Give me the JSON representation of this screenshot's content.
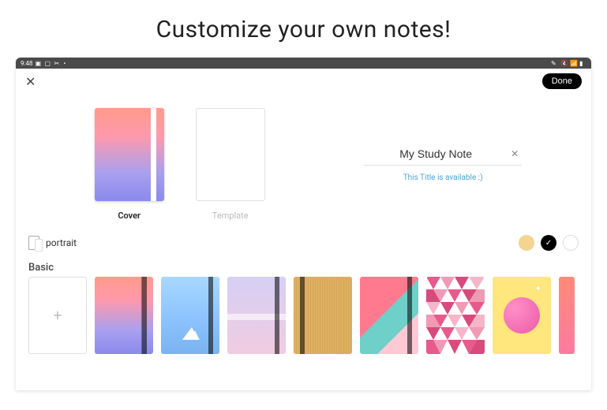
{
  "page_title": "Customize your own notes!",
  "status": {
    "time": "9:48"
  },
  "header": {
    "done_label": "Done"
  },
  "tabs": {
    "cover": "Cover",
    "template": "Template"
  },
  "note": {
    "title_value": "My Study Note",
    "availability_hint": "This Title is available :)"
  },
  "options": {
    "orientation_label": "portrait",
    "swatches": [
      {
        "color": "#f5d490",
        "selected": false
      },
      {
        "color": "#000000",
        "selected": true
      },
      {
        "color": "#ffffff",
        "selected": false
      }
    ]
  },
  "section_label": "Basic",
  "covers": [
    {
      "kind": "add"
    },
    {
      "kind": "gradient-pink-blue"
    },
    {
      "kind": "sky-mountain"
    },
    {
      "kind": "pastel-split"
    },
    {
      "kind": "wood"
    },
    {
      "kind": "geo-pink-teal"
    },
    {
      "kind": "triangles-pink"
    },
    {
      "kind": "planet-yellow"
    },
    {
      "kind": "coral-slice"
    }
  ]
}
